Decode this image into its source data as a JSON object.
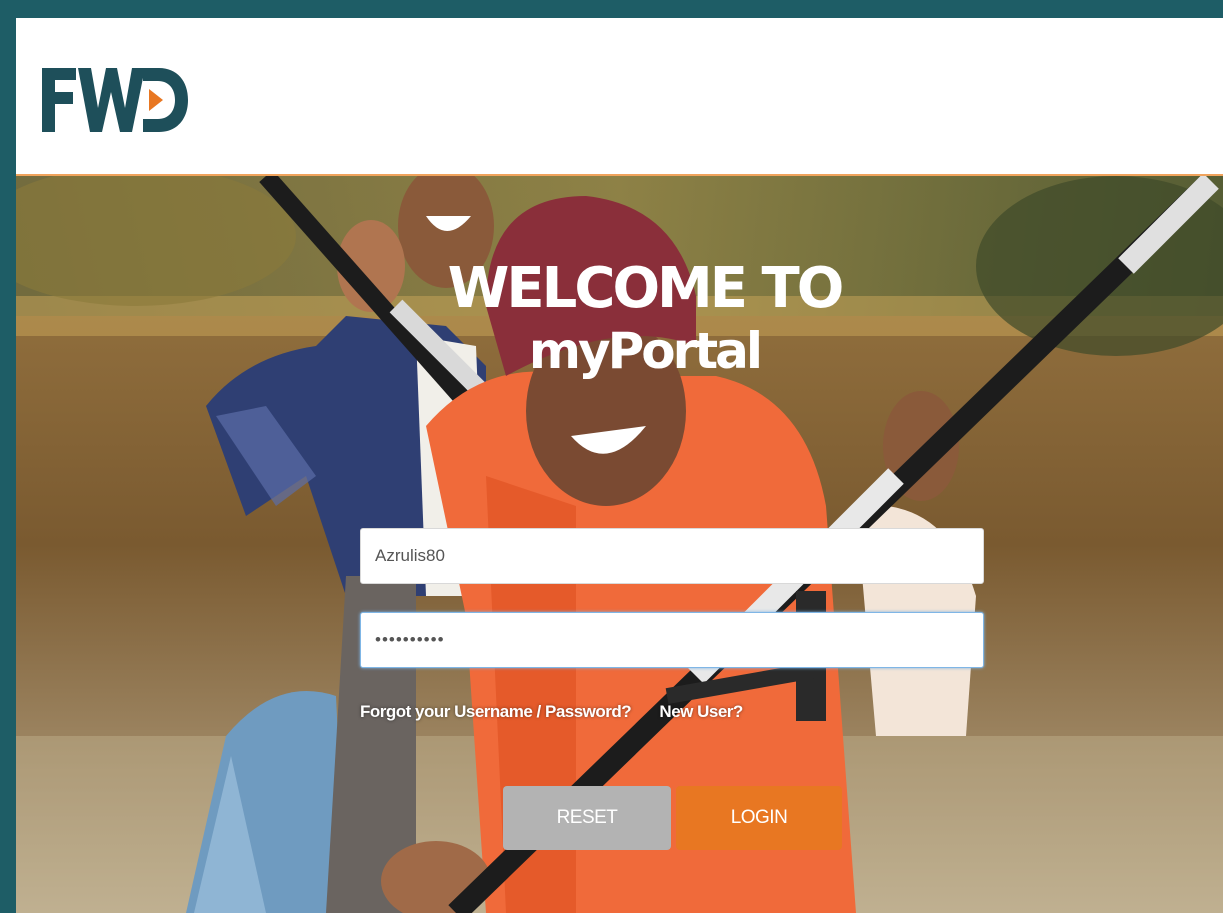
{
  "header": {
    "logo_text": "FWD",
    "colors": {
      "logo": "#1e4f5a",
      "logo_accent": "#e87722"
    }
  },
  "hero": {
    "welcome_line1": "WELCOME TO",
    "welcome_line2": "myPortal"
  },
  "login_form": {
    "username_value": "Azrulis80",
    "password_masked": "••••••••••",
    "forgot_link": "Forgot your Username / Password?",
    "new_user_link": "New User?",
    "reset_label": "RESET",
    "login_label": "LOGIN",
    "colors": {
      "reset": "#b3b3b3",
      "login": "#e87722"
    }
  }
}
